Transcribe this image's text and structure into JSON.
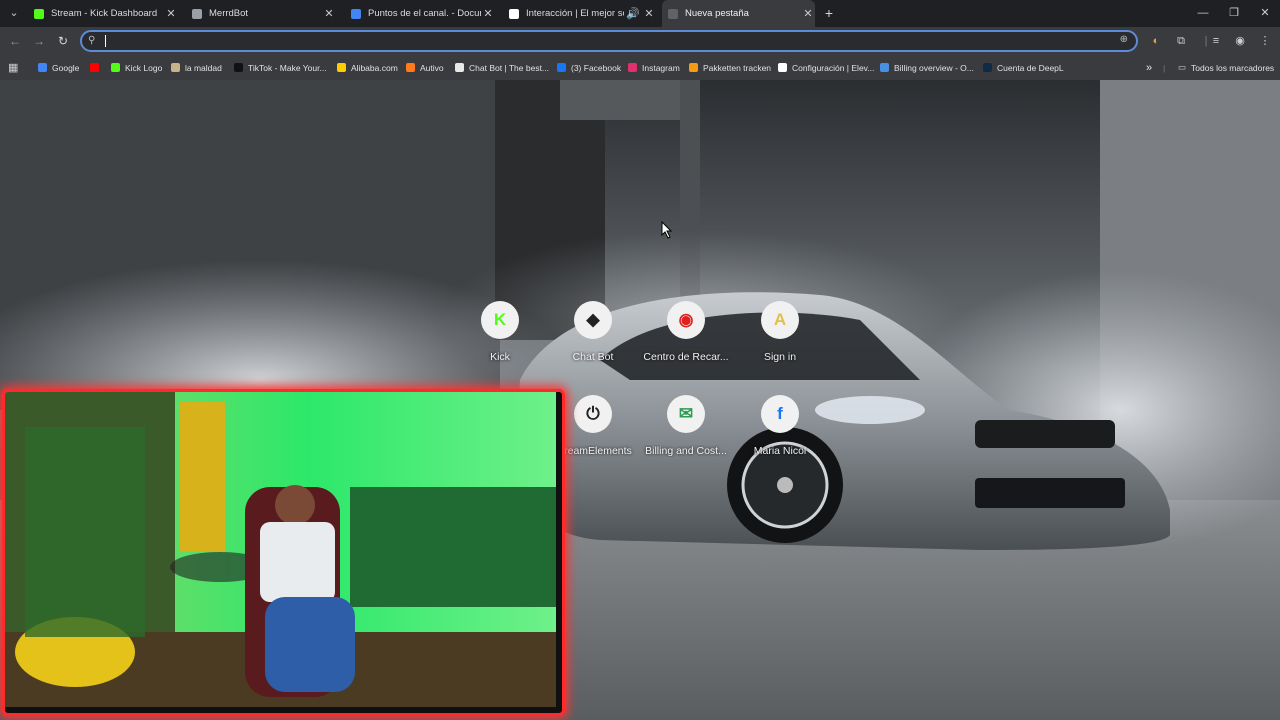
{
  "tabs": [
    {
      "title": "Stream - Kick Dashboard",
      "favicon_color": "#53fc18",
      "active": false
    },
    {
      "title": "MerrdBot",
      "favicon_color": "#9aa0a6",
      "active": false
    },
    {
      "title": "Puntos de el canal. - Document",
      "favicon_color": "#4285f4",
      "active": false
    },
    {
      "title": "Interacción | El mejor softw",
      "favicon_color": "#ffffff",
      "active": false
    },
    {
      "title": "Nueva pestaña",
      "favicon_color": "#5f6368",
      "active": true
    }
  ],
  "tab_menu_icon": "chevron-down-icon",
  "new_tab_icon": "plus-icon",
  "omnibox": {
    "value": "",
    "placeholder": ""
  },
  "bookmarks": [
    {
      "label": "Google",
      "color": "#4285f4"
    },
    {
      "label": "",
      "color": "#ff0000"
    },
    {
      "label": "Kick Logo",
      "color": "#53fc18"
    },
    {
      "label": "la maldad",
      "color": "#c7b38a"
    },
    {
      "label": "TikTok - Make Your...",
      "color": "#111111"
    },
    {
      "label": "Alibaba.com",
      "color": "#ffcc00"
    },
    {
      "label": "Autivo",
      "color": "#ff7a1a"
    },
    {
      "label": "Chat Bot | The best...",
      "color": "#e8e8e8"
    },
    {
      "label": "(3) Facebook",
      "color": "#1877f2"
    },
    {
      "label": "Instagram",
      "color": "#e1306c"
    },
    {
      "label": "Pakketten tracken",
      "color": "#f39c12"
    },
    {
      "label": "Configuración | Elev...",
      "color": "#ffffff"
    },
    {
      "label": "Billing overview - O...",
      "color": "#4a90e2"
    },
    {
      "label": "Cuenta de DeepL",
      "color": "#0f2b46"
    }
  ],
  "bookmarks_overflow": "»",
  "all_bookmarks_label": "Todos los marcadores",
  "shortcuts": [
    {
      "label": "Kick",
      "glyph": "K",
      "color": "#53fc18",
      "icon": "kick-icon"
    },
    {
      "label": "Chat Bot",
      "glyph": "◆",
      "color": "#222222",
      "icon": "chatbot-icon"
    },
    {
      "label": "Centro de Recar...",
      "glyph": "◉",
      "color": "#e02020",
      "icon": "recharge-center-icon"
    },
    {
      "label": "Sign in",
      "glyph": "A",
      "color": "#e0c050",
      "icon": "sign-in-icon"
    },
    {
      "label": "StreamElements",
      "glyph": "⏻",
      "color": "#222222",
      "icon": "streamelements-icon"
    },
    {
      "label": "Billing and Cost...",
      "glyph": "✉",
      "color": "#2e9c52",
      "icon": "billing-icon"
    },
    {
      "label": "Maria Nicol",
      "glyph": "f",
      "color": "#1877f2",
      "icon": "facebook-icon"
    }
  ]
}
